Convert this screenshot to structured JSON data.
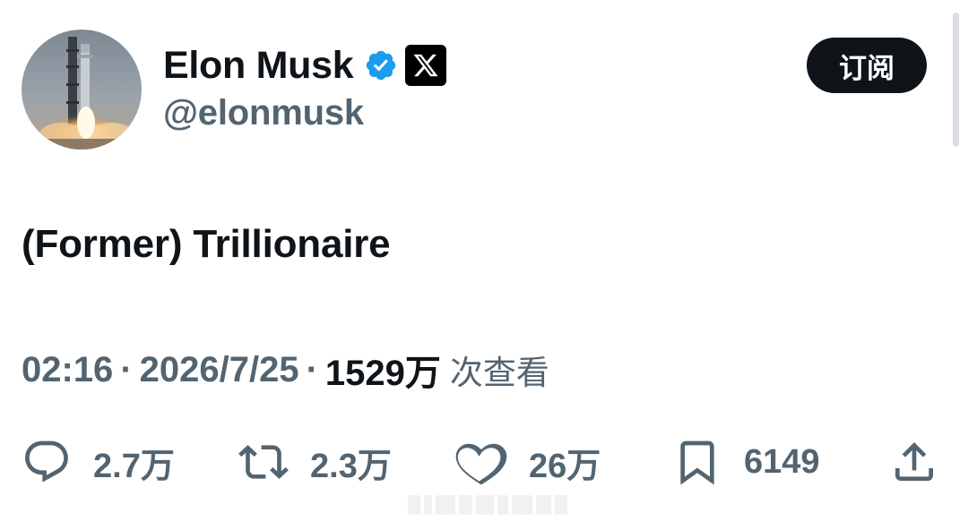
{
  "author": {
    "display_name": "Elon Musk",
    "handle": "@elonmusk",
    "verified_icon": "verified-badge-icon",
    "affiliation_icon": "x-logo-icon",
    "verified_color": "#1d9bf0"
  },
  "subscribe_label": "订阅",
  "tweet": {
    "text": "(Former) Trillionaire",
    "time": "02:16",
    "separator": "·",
    "date": "2026/7/25",
    "views_count": "1529万",
    "views_label": "次查看"
  },
  "actions": {
    "replies": "2.7万",
    "retweets": "2.3万",
    "likes": "26万",
    "bookmarks": "6149"
  },
  "colors": {
    "text_primary": "#0f1419",
    "text_secondary": "#536471",
    "button_bg": "#0f1419"
  }
}
